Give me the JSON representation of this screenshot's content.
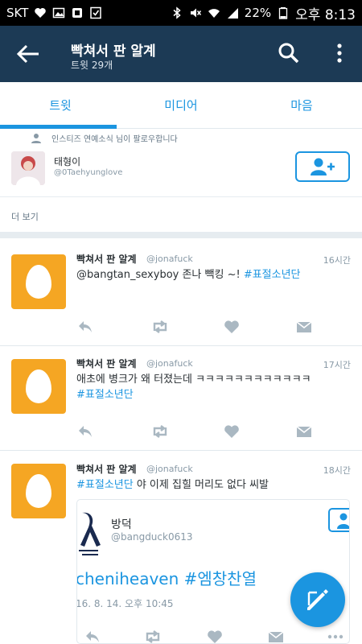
{
  "status_bar": {
    "carrier": "SKT",
    "battery": "22%",
    "time": "오후 8:13"
  },
  "header": {
    "title": "빡쳐서 판 알계",
    "subtitle": "트윗 29개"
  },
  "tabs": [
    {
      "label": "트윗",
      "selected": true
    },
    {
      "label": "미디어",
      "selected": false
    },
    {
      "label": "마음",
      "selected": false
    }
  ],
  "follow_suggestion": {
    "note": "인스티즈 연예소식 님이 팔로우합니다",
    "name": "태형이",
    "handle": "@0Taehyunglove",
    "see_more": "더 보기"
  },
  "tweets": [
    {
      "name": "빡쳐서 판 알계",
      "handle": "@jonafuck",
      "time": "16시간",
      "text": "@bangtan_sexyboy 존나 빽킹 ~! ",
      "hashtag": "#표절소년단"
    },
    {
      "name": "빡쳐서 판 알계",
      "handle": "@jonafuck",
      "time": "17시간",
      "text": "애초에 병크가 왜 터졌는데 ㅋㅋㅋㅋㅋㅋㅋㅋㅋㅋㅋㅋ",
      "hashtag": "#표절소년단"
    },
    {
      "name": "빡쳐서 판 알계",
      "handle": "@jonafuck",
      "time": "18시간",
      "hashtag": "#표절소년단",
      "text": " 야 이제 집힐 머리도 없다 씨발",
      "quote": {
        "name": "방덕",
        "handle": "@bangduck0613",
        "text": "cheniheaven #엠창찬열",
        "date": "16. 8. 14. 오후 10:45"
      }
    }
  ],
  "colors": {
    "header_bg": "#1c3a55",
    "accent": "#1b95e0",
    "egg_bg": "#f5a623"
  }
}
